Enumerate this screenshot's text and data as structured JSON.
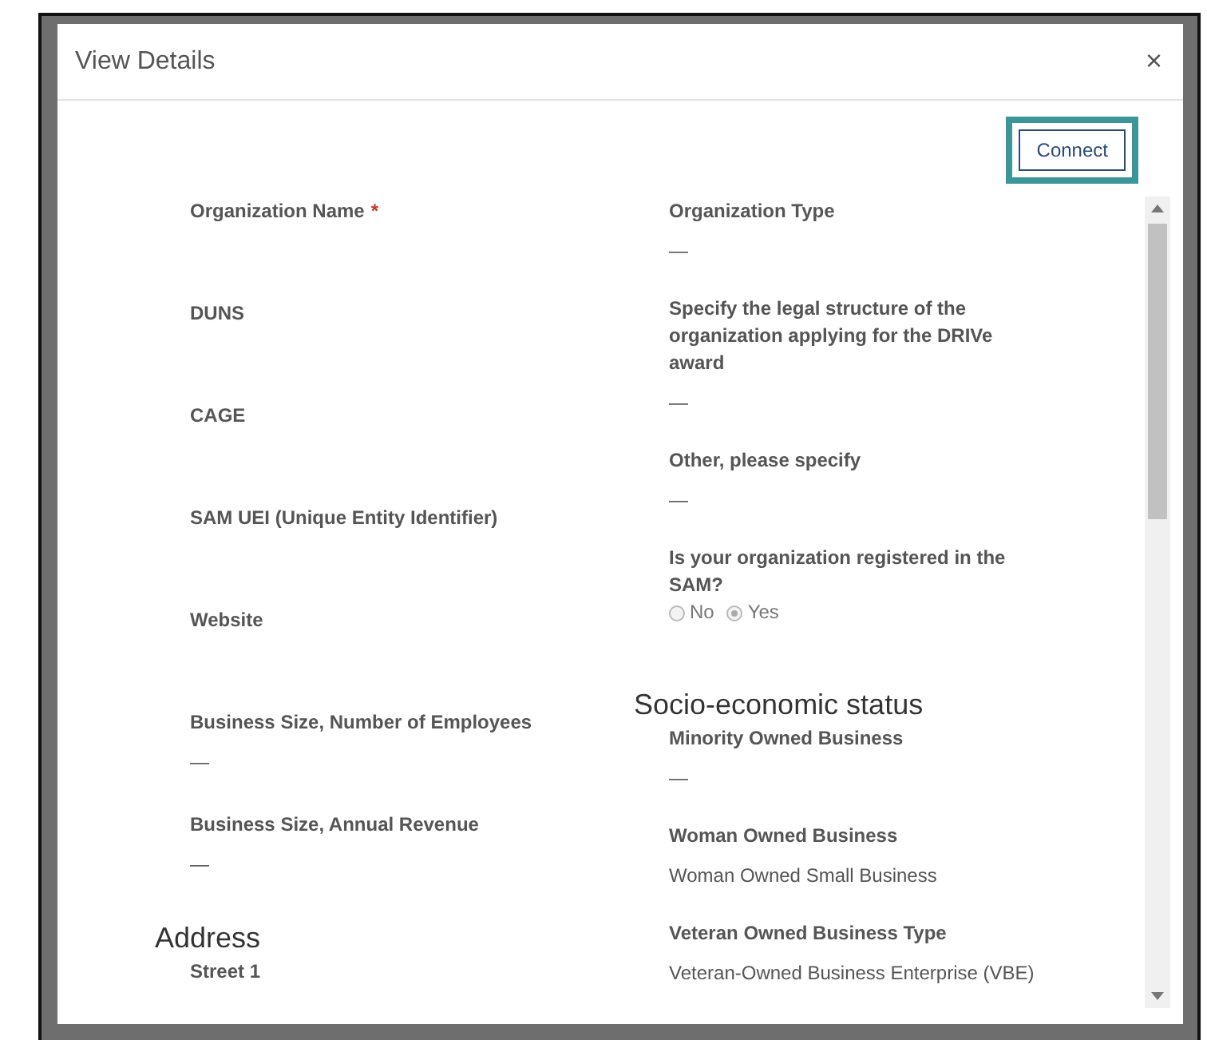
{
  "dialog": {
    "title": "View Details",
    "close": "×",
    "connect": {
      "label": "Connect",
      "highlighted": true
    },
    "left_column": [
      {
        "kind": "field",
        "label": "Organization Name",
        "required_mark": "*"
      },
      {
        "kind": "field",
        "label": "DUNS"
      },
      {
        "kind": "field",
        "label": "CAGE"
      },
      {
        "kind": "field",
        "label": "SAM UEI (Unique Entity Identifier)"
      },
      {
        "kind": "field",
        "label": "Website"
      },
      {
        "kind": "field",
        "label": "Business Size, Number of Employees",
        "value": "—"
      },
      {
        "kind": "field",
        "label": "Business Size, Annual Revenue",
        "value": "—"
      },
      {
        "kind": "heading",
        "text": "Address"
      },
      {
        "kind": "field",
        "label": "Street 1"
      }
    ],
    "right_column": [
      {
        "kind": "field",
        "label": "Organization Type",
        "value": "—"
      },
      {
        "kind": "field",
        "label": "Specify the legal structure of the organization applying for the DRIVe award",
        "value": "—"
      },
      {
        "kind": "field",
        "label": "Other, please specify",
        "value": "—"
      },
      {
        "kind": "radio",
        "label": "Is your organization registered in the SAM?",
        "options": [
          {
            "label": "No",
            "selected": false
          },
          {
            "label": "Yes",
            "selected": true
          }
        ]
      },
      {
        "kind": "heading",
        "text": "Socio-economic status"
      },
      {
        "kind": "field",
        "label": "Minority Owned Business",
        "value": "—"
      },
      {
        "kind": "field",
        "label": "Woman Owned Business",
        "value": "Woman Owned Small Business"
      },
      {
        "kind": "field",
        "label": "Veteran Owned Business Type",
        "value": "Veteran-Owned Business Enterprise (VBE)"
      }
    ]
  }
}
